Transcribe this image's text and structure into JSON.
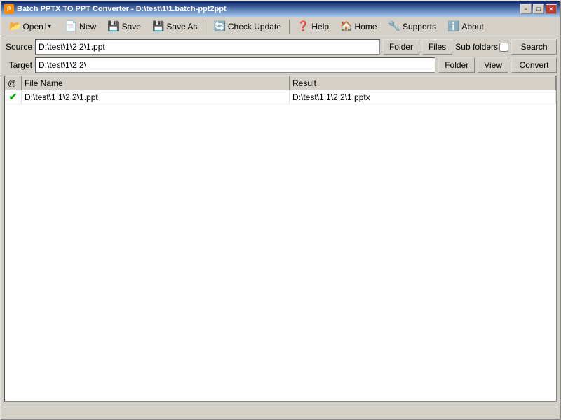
{
  "window": {
    "title": "Batch PPTX TO PPT Converter - D:\\test\\1\\1.batch-ppt2ppt",
    "icon": "P"
  },
  "titlebar": {
    "minimize_label": "−",
    "maximize_label": "□",
    "close_label": "✕"
  },
  "toolbar": {
    "open_label": "Open",
    "new_label": "New",
    "save_label": "Save",
    "save_as_label": "Save As",
    "check_update_label": "Check Update",
    "help_label": "Help",
    "home_label": "Home",
    "supports_label": "Supports",
    "about_label": "About"
  },
  "source": {
    "label": "Source",
    "value": "D:\\test\\1\\2 2\\1.ppt",
    "folder_btn": "Folder",
    "files_btn": "Files",
    "subfolder_label": "Sub folders",
    "search_btn": "Search"
  },
  "target": {
    "label": "Target",
    "value": "D:\\test\\1\\2 2\\",
    "folder_btn": "Folder",
    "view_btn": "View",
    "convert_btn": "Convert"
  },
  "table": {
    "headers": {
      "at": "@",
      "filename": "File Name",
      "result": "Result"
    },
    "rows": [
      {
        "status": "✔",
        "filename": "D:\\test\\1 1\\2 2\\1.ppt",
        "result": "D:\\test\\1 1\\2 2\\1.pptx"
      }
    ]
  },
  "status": {
    "text": ""
  }
}
